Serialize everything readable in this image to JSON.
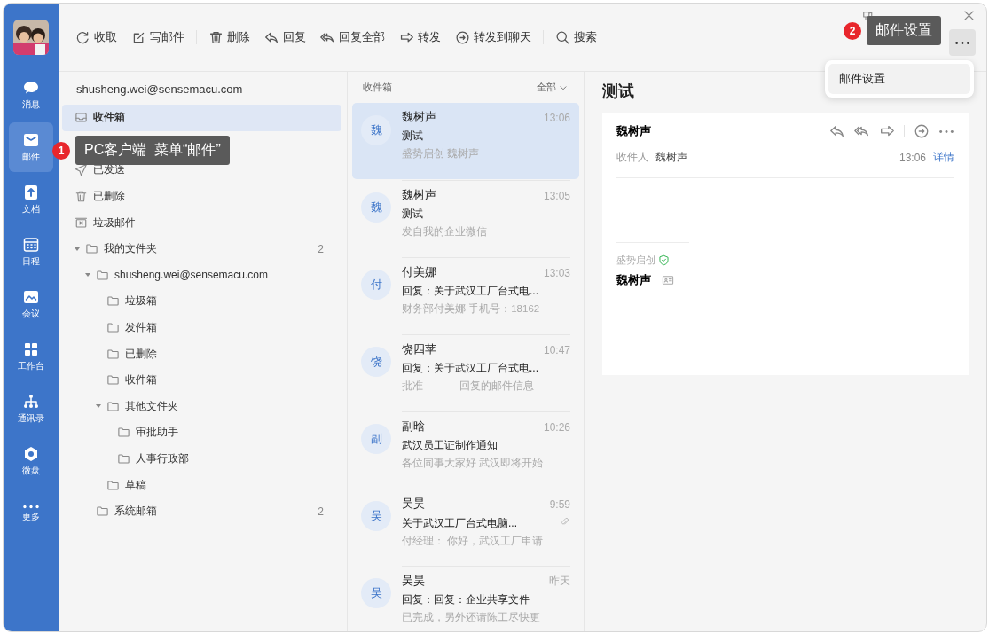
{
  "nav": {
    "items": [
      {
        "label": "消息",
        "selected": false
      },
      {
        "label": "邮件",
        "selected": true
      },
      {
        "label": "文档",
        "selected": false
      },
      {
        "label": "日程",
        "selected": false
      },
      {
        "label": "会议",
        "selected": false
      },
      {
        "label": "工作台",
        "selected": false
      },
      {
        "label": "通讯录",
        "selected": false
      },
      {
        "label": "微盘",
        "selected": false
      },
      {
        "label": "更多",
        "selected": false
      }
    ]
  },
  "toolbar": [
    {
      "label": "收取"
    },
    {
      "label": "写邮件"
    },
    {
      "label": "删除"
    },
    {
      "label": "回复"
    },
    {
      "label": "回复全部"
    },
    {
      "label": "转发"
    },
    {
      "label": "转发到聊天"
    },
    {
      "label": "搜索"
    }
  ],
  "more_button": {
    "active": true
  },
  "menu": {
    "items": [
      "邮件设置"
    ]
  },
  "tooltips": [
    {
      "number": "1",
      "text": "PC客户端  菜单“邮件”"
    },
    {
      "number": "2",
      "text": "邮件设置"
    }
  ],
  "folders": {
    "account": "shusheng.wei@sensemacu.com",
    "items": [
      {
        "kind": "inbox",
        "label": "收件箱",
        "selected": true
      },
      {
        "kind": "covered"
      },
      {
        "kind": "sent",
        "label": "已发送",
        "selected": false
      },
      {
        "kind": "trash",
        "label": "已删除",
        "selected": false
      },
      {
        "kind": "spam",
        "label": "垃圾邮件",
        "selected": false
      },
      {
        "kind": "folder",
        "label": "我的文件夹",
        "selected": false,
        "count": "2",
        "expanded": true,
        "children": [
          {
            "kind": "folder",
            "label": "shusheng.wei@sensemacu.com",
            "selected": false,
            "expanded": true,
            "children": [
              {
                "kind": "folder",
                "label": "垃圾箱",
                "selected": false
              },
              {
                "kind": "folder",
                "label": "发件箱",
                "selected": false
              },
              {
                "kind": "folder",
                "label": "已删除",
                "selected": false
              },
              {
                "kind": "folder",
                "label": "收件箱",
                "selected": false
              },
              {
                "kind": "folder",
                "label": "其他文件夹",
                "selected": false,
                "expanded": true,
                "children": [
                  {
                    "kind": "folder",
                    "label": "审批助手",
                    "selected": false
                  },
                  {
                    "kind": "folder",
                    "label": "人事行政部",
                    "selected": false
                  }
                ]
              },
              {
                "kind": "folder",
                "label": "草稿",
                "selected": false
              }
            ]
          },
          {
            "kind": "folder",
            "label": "系统邮箱",
            "selected": false,
            "count": "2"
          }
        ]
      }
    ]
  },
  "list": {
    "title": "收件箱",
    "filter": "全部",
    "messages": [
      {
        "avatar": "魏",
        "sender": "魏树声",
        "time": "13:06",
        "subject": "测试",
        "preview": "盛势启创 魏树声",
        "selected": true,
        "attachment": false
      },
      {
        "avatar": "魏",
        "sender": "魏树声",
        "time": "13:05",
        "subject": "测试",
        "preview": "发自我的企业微信",
        "selected": false,
        "attachment": false
      },
      {
        "avatar": "付",
        "sender": "付美娜",
        "time": "13:03",
        "subject": "回复：关于武汉工厂台式电...",
        "preview": "财务部付美娜 手机号：18162",
        "selected": false,
        "attachment": false
      },
      {
        "avatar": "饶",
        "sender": "饶四苹",
        "time": "10:47",
        "subject": "回复：关于武汉工厂台式电...",
        "preview": "批准 ----------回复的邮件信息",
        "selected": false,
        "attachment": false
      },
      {
        "avatar": "副",
        "sender": "副晗",
        "time": "10:26",
        "subject": "武汉员工证制作通知",
        "preview": "各位同事大家好 武汉即将开始",
        "selected": false,
        "attachment": false
      },
      {
        "avatar": "吴",
        "sender": "吴昊",
        "time": "9:59",
        "subject": "关于武汉工厂台式电脑...",
        "preview": "付经理： 你好，武汉工厂申请",
        "selected": false,
        "attachment": true
      },
      {
        "avatar": "吴",
        "sender": "吴昊",
        "time": "昨天",
        "subject": "回复：回复：企业共享文件",
        "preview": "已完成，另外还请陈工尽快更",
        "selected": false,
        "attachment": false
      }
    ]
  },
  "reader": {
    "title": "测试",
    "sender": "魏树声",
    "recipient_label": "收件人",
    "recipient": "魏树声",
    "time": "13:06",
    "details_link": "详情",
    "signature_company": "盛势启创",
    "signature_name": "魏树声"
  }
}
